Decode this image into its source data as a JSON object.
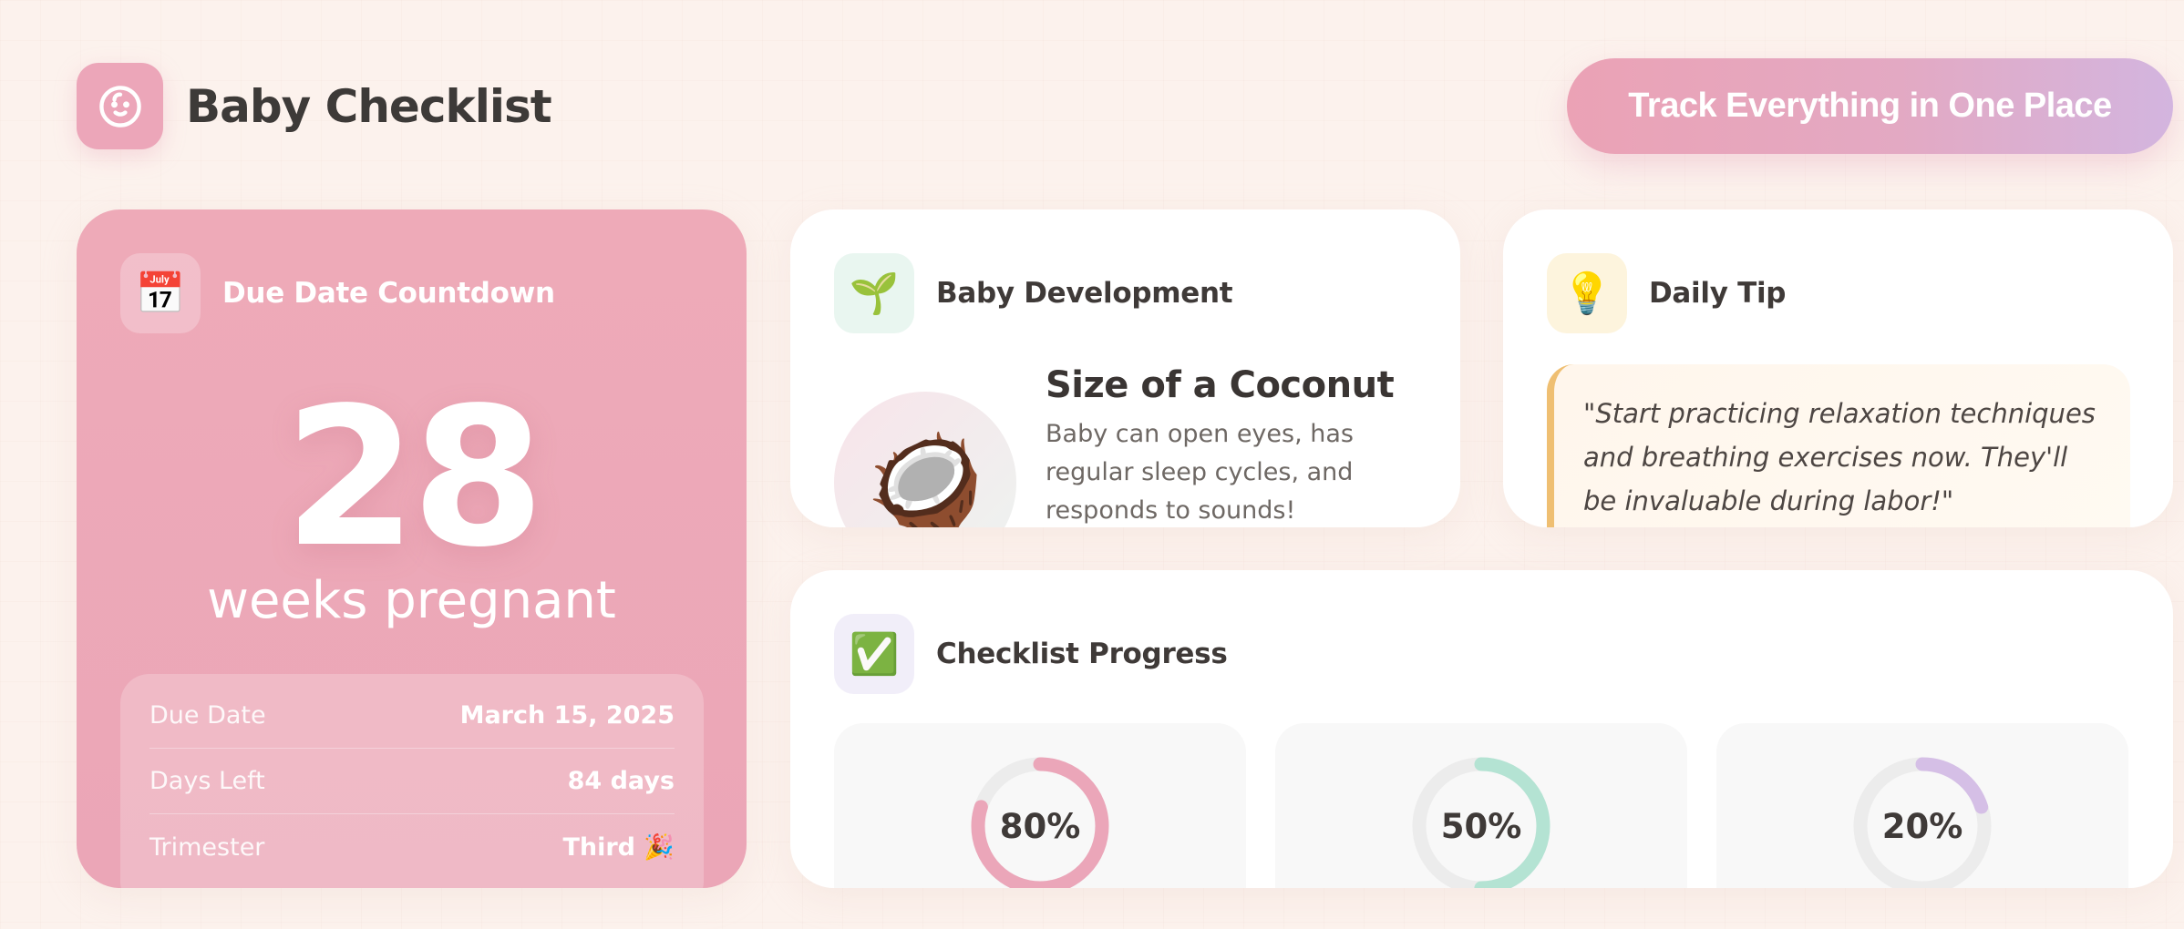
{
  "header": {
    "brand_title": "Baby Checklist",
    "cta_label": "Track Everything in One Place"
  },
  "countdown": {
    "title": "Due Date Countdown",
    "icon": "📅",
    "weeks": "28",
    "weeks_label": "weeks pregnant",
    "rows": [
      {
        "label": "Due Date",
        "value": "March 15, 2025"
      },
      {
        "label": "Days Left",
        "value": "84 days"
      },
      {
        "label": "Trimester",
        "value": "Third 🎉"
      }
    ]
  },
  "development": {
    "title": "Baby Development",
    "icon": "🌱",
    "fruit_icon": "🥥",
    "size_title": "Size of a Coconut",
    "description": "Baby can open eyes, has regular sleep cycles, and responds to sounds!"
  },
  "tip": {
    "title": "Daily Tip",
    "icon": "💡",
    "quote": "\"Start practicing relaxation techniques and breathing exercises now. They'll be invaluable during labor!\""
  },
  "progress": {
    "title": "Checklist Progress",
    "icon": "✅",
    "items": [
      {
        "label": "80%",
        "value": 0.8,
        "color": "#eba6b9"
      },
      {
        "label": "50%",
        "value": 0.5,
        "color": "#b4e3d3"
      },
      {
        "label": "20%",
        "value": 0.2,
        "color": "#d5bfe6"
      }
    ],
    "track_color": "#ececec"
  }
}
